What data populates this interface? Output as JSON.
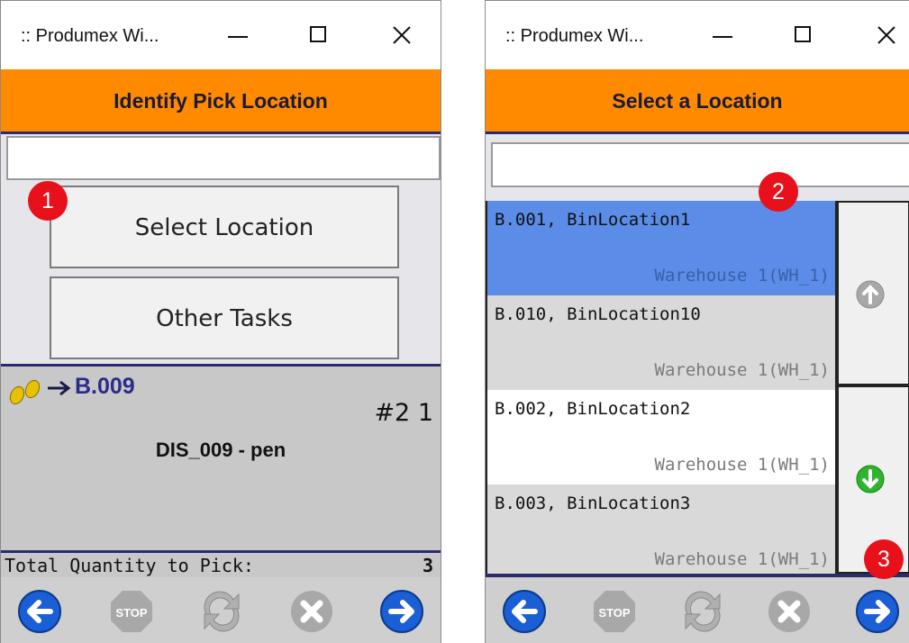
{
  "left_window": {
    "title": ":: Produmex Wi...",
    "header": "Identify Pick Location",
    "search_value": "",
    "buttons": {
      "select_location": "Select Location",
      "other_tasks": "Other Tasks"
    },
    "pick": {
      "location": "B.009",
      "sequence": "#2 1",
      "item": "DIS_009 - pen"
    },
    "total_label": "Total Quantity to Pick:",
    "total_value": "3",
    "badge": "1"
  },
  "right_window": {
    "title": ":: Produmex Wi...",
    "header": "Select a Location",
    "search_value": "",
    "locations": [
      {
        "code": "B.001, BinLocation1",
        "warehouse": "Warehouse 1(WH_1)",
        "selected": true
      },
      {
        "code": "B.010, BinLocation10",
        "warehouse": "Warehouse 1(WH_1)",
        "selected": false
      },
      {
        "code": "B.002, BinLocation2",
        "warehouse": "Warehouse 1(WH_1)",
        "selected": false
      },
      {
        "code": "B.003, BinLocation3",
        "warehouse": "Warehouse 1(WH_1)",
        "selected": false
      }
    ],
    "badge_list": "2",
    "badge_next": "3"
  },
  "toolbar": {
    "icons": [
      "back-arrow-icon",
      "stop-icon",
      "refresh-icon",
      "cancel-icon",
      "next-arrow-icon"
    ],
    "stop_label": "STOP"
  },
  "colors": {
    "header_orange": "#ff8a00",
    "selected_row": "#5b8de8",
    "badge_red": "#e8101a",
    "navy": "#2b2b6e"
  }
}
